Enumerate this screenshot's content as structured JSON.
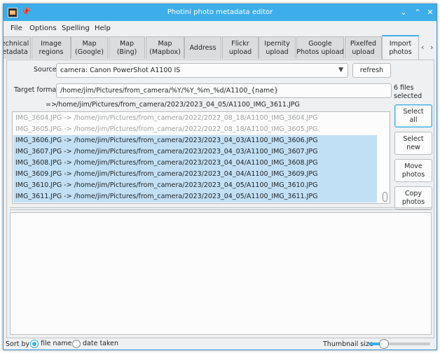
{
  "window": {
    "title": "Photini photo metadata editor"
  },
  "titlebar": {
    "minimize": "⌄",
    "maximize": "⌃",
    "close": "✕",
    "pin": "📌"
  },
  "menu": [
    "File",
    "Options",
    "Spelling",
    "Help"
  ],
  "tabs": [
    "echnical\netadata",
    "Image\nregions",
    "Map\n(Google)",
    "Map\n(Bing)",
    "Map\n(Mapbox)",
    "Address",
    "Flickr\nupload",
    "Ipernity\nupload",
    "Google\nPhotos upload",
    "Pixelfed\nupload",
    "Import\nphotos"
  ],
  "active_tab_index": 10,
  "import": {
    "source_label": "Source",
    "source_value": "camera: Canon PowerShot A1100 IS",
    "refresh_label": "refresh",
    "target_label": "Target format",
    "target_value": "/home/jim/Pictures/from_camera/%Y/%Y_%m_%d/A1100_{name}",
    "preview_arrow": "=>",
    "preview_path": "/home/jim/Pictures/from_camera/2023/2023_04_05/A1100_IMG_3611.JPG",
    "files_selected": "6 files\nselected",
    "buttons": {
      "select_all": "Select\nall",
      "select_new": "Select\nnew",
      "move_photos": "Move\nphotos",
      "copy_photos": "Copy\nphotos"
    },
    "files": [
      {
        "text": "IMG_3604.JPG -> /home/jim/Pictures/from_camera/2022/2022_08_18/A1100_IMG_3604.JPG",
        "state": "greyed"
      },
      {
        "text": "IMG_3605.JPG -> /home/jim/Pictures/from_camera/2022/2022_08_18/A1100_IMG_3605.JPG",
        "state": "greyed"
      },
      {
        "text": "IMG_3606.JPG -> /home/jim/Pictures/from_camera/2023/2023_04_03/A1100_IMG_3606.JPG",
        "state": "selected"
      },
      {
        "text": "IMG_3607.JPG -> /home/jim/Pictures/from_camera/2023/2023_04_03/A1100_IMG_3607.JPG",
        "state": "selected"
      },
      {
        "text": "IMG_3608.JPG -> /home/jim/Pictures/from_camera/2023/2023_04_04/A1100_IMG_3608.JPG",
        "state": "selected"
      },
      {
        "text": "IMG_3609.JPG -> /home/jim/Pictures/from_camera/2023/2023_04_04/A1100_IMG_3609.JPG",
        "state": "selected"
      },
      {
        "text": "IMG_3610.JPG -> /home/jim/Pictures/from_camera/2023/2023_04_05/A1100_IMG_3610.JPG",
        "state": "selected"
      },
      {
        "text": "IMG_3611.JPG -> /home/jim/Pictures/from_camera/2023/2023_04_05/A1100_IMG_3611.JPG",
        "state": "selected"
      }
    ]
  },
  "bottom": {
    "sort_by_label": "Sort by",
    "sort_options": [
      "file name",
      "date taken"
    ],
    "sort_selected_index": 0,
    "thumbnail_size_label": "Thumbnail size",
    "thumbnail_size_fraction": 0.25
  },
  "colors": {
    "accent": "#3daee9",
    "selection": "#c2e0f5",
    "window_bg": "#eff0f1"
  }
}
